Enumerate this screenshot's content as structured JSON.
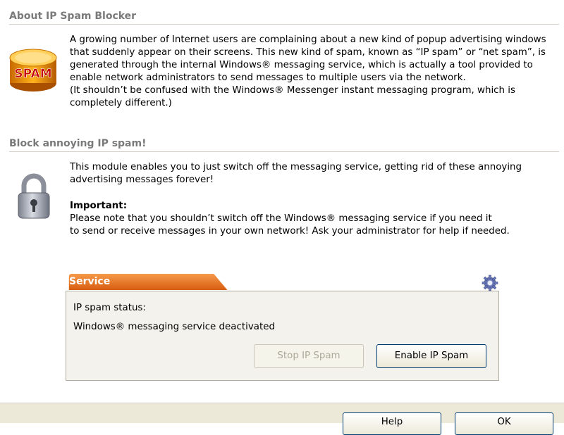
{
  "about": {
    "heading": "About IP Spam Blocker",
    "lines": [
      "A growing number of Internet users are complaining about a new kind of popup advertising windows",
      "that suddenly appear on their screens. This new kind of spam, known as “IP spam” or “net spam”, is",
      "generated through the internal Windows® messaging service, which is actually a tool provided to",
      "enable network administrators to send messages to multiple users via the network.",
      "(It shouldn’t be confused with the Windows® Messenger instant messaging program, which is",
      "completely different.)"
    ],
    "icon": "spam-can-icon",
    "icon_text": "SPAM"
  },
  "block": {
    "heading": "Block annoying IP spam!",
    "intro_lines": [
      "This module enables you to just switch off the messaging service, getting rid of these annoying",
      "advertising messages forever!"
    ],
    "important_label": "Important:",
    "note_lines": [
      "Please note that you shouldn’t switch off the Windows® messaging service if you need it",
      "to send or receive messages in your own network! Ask your administrator for help if needed."
    ],
    "icon": "padlock-icon"
  },
  "service": {
    "tab_label": "Service",
    "status_label": "IP spam status:",
    "status_value": "Windows® messaging service deactivated",
    "stop_button": "Stop IP Spam",
    "enable_button": "Enable IP Spam",
    "settings_icon": "gear-icon"
  },
  "footer": {
    "buttons": [
      "Help",
      "OK"
    ]
  },
  "colors": {
    "tab_orange": "#e8701a",
    "heading_gray": "#7a7a7a"
  }
}
